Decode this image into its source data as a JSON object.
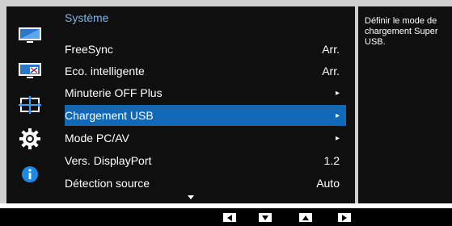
{
  "menu": {
    "title": "Système",
    "items": [
      {
        "label": "FreeSync",
        "value": "Arr."
      },
      {
        "label": "Eco. intelligente",
        "value": "Arr."
      },
      {
        "label": "Minuterie OFF Plus",
        "value": "▸"
      },
      {
        "label": "Chargement USB",
        "value": "▸"
      },
      {
        "label": "Mode PC/AV",
        "value": "▸"
      },
      {
        "label": "Vers. DisplayPort",
        "value": "1.2"
      },
      {
        "label": "Détection source",
        "value": "Auto"
      }
    ],
    "selected_index": 3
  },
  "help": {
    "text": "Définir le mode de chargement Super USB."
  },
  "sidebar": {
    "icons": [
      "picture-icon",
      "color-icon",
      "screen-size-icon",
      "system-gear-icon",
      "info-icon"
    ]
  },
  "footer": {
    "buttons": [
      "left-button",
      "down-button",
      "up-button",
      "right-button"
    ]
  },
  "colors": {
    "accent": "#1068b8",
    "title": "#7fb6e6",
    "background": "#0f0f10"
  }
}
